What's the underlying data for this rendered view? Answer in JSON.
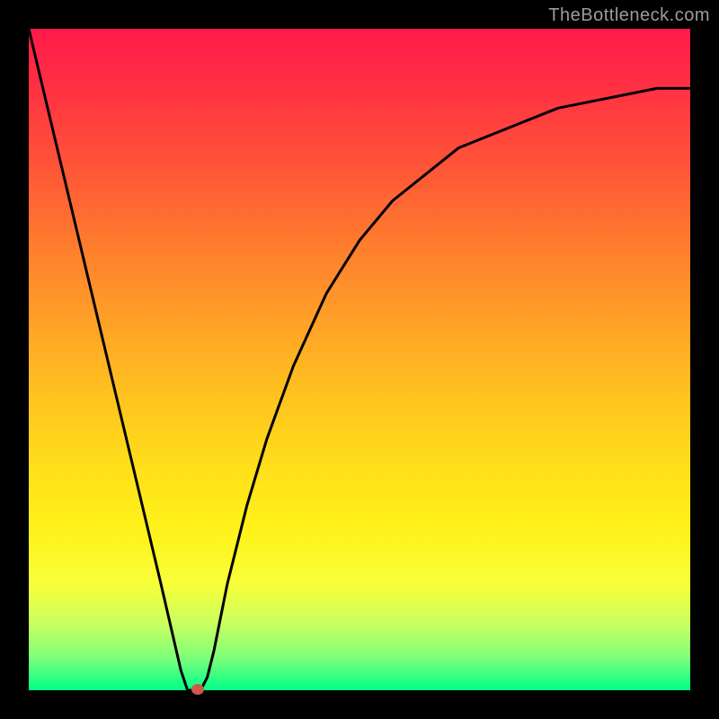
{
  "credit": "TheBottleneck.com",
  "chart_data": {
    "type": "line",
    "title": "",
    "xlabel": "",
    "ylabel": "",
    "xlim": [
      0,
      100
    ],
    "ylim": [
      0,
      100
    ],
    "grid": false,
    "series": [
      {
        "name": "curve",
        "x": [
          0,
          5,
          10,
          15,
          20,
          23,
          24,
          25,
          26,
          27,
          28,
          30,
          33,
          36,
          40,
          45,
          50,
          55,
          60,
          65,
          70,
          75,
          80,
          85,
          90,
          95,
          100
        ],
        "values": [
          100,
          79,
          58,
          37,
          16,
          3,
          0,
          0,
          0,
          2,
          6,
          16,
          28,
          38,
          49,
          60,
          68,
          74,
          78,
          82,
          84,
          86,
          88,
          89,
          90,
          91,
          91
        ]
      }
    ],
    "marker": {
      "x": 25.5,
      "y": 0
    },
    "background_gradient": {
      "top": "#ff1a4a",
      "bottom": "#00ff88",
      "stops": [
        {
          "pos": 0,
          "color": "#ff1a4a"
        },
        {
          "pos": 0.2,
          "color": "#ff5238"
        },
        {
          "pos": 0.44,
          "color": "#ffa028"
        },
        {
          "pos": 0.68,
          "color": "#ffe31a"
        },
        {
          "pos": 0.9,
          "color": "#c8ff60"
        },
        {
          "pos": 1,
          "color": "#00ff88"
        }
      ]
    }
  }
}
